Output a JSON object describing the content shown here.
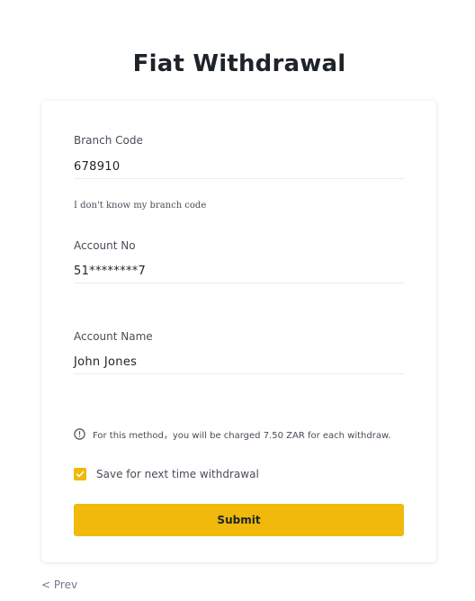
{
  "page": {
    "title": "Fiat Withdrawal"
  },
  "form": {
    "branch_code": {
      "label": "Branch Code",
      "value": "678910"
    },
    "help_link": "I don't know my branch code",
    "account_no": {
      "label": "Account No",
      "value": "51********7"
    },
    "account_name": {
      "label": "Account Name",
      "value": "John Jones"
    },
    "notice": {
      "icon": "info-circle-icon",
      "text": "For this method，you will be charged 7.50 ZAR for each withdraw."
    },
    "save_checkbox": {
      "checked": true,
      "label": "Save for next time withdrawal"
    },
    "submit_label": "Submit"
  },
  "nav": {
    "prev_label": "< Prev"
  },
  "colors": {
    "accent": "#f0b90b",
    "text": "#1e2329",
    "muted": "#474d57",
    "divider": "#eaecef"
  }
}
